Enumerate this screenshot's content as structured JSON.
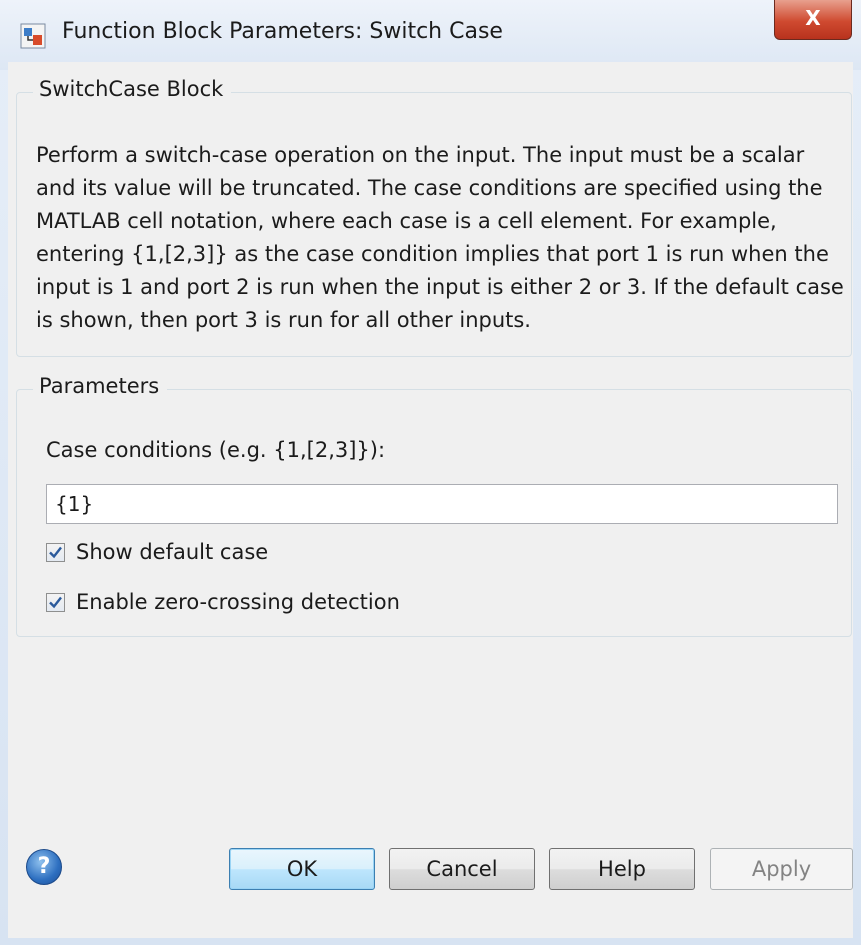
{
  "window": {
    "title": "Function Block Parameters: Switch Case",
    "close_glyph": "X",
    "icon": "simulink-block-icon"
  },
  "block_section": {
    "legend": "SwitchCase Block",
    "description": "Perform a switch-case operation on the input.  The input must be a scalar and its value will be truncated.  The case conditions are specified using the MATLAB cell notation, where each case is a cell element.  For example, entering {1,[2,3]} as the case condition implies that port 1 is run when the input is 1 and port 2 is run when the input is either 2 or 3.  If the default case is shown, then port 3 is run for all other inputs."
  },
  "parameters": {
    "legend": "Parameters",
    "case_conditions_label": "Case conditions (e.g. {1,[2,3]}):",
    "case_conditions_value": "{1}",
    "show_default_case": {
      "label": "Show default case",
      "checked": true
    },
    "zero_crossing": {
      "label": "Enable zero-crossing detection",
      "checked": true
    }
  },
  "buttons": {
    "help_icon_glyph": "?",
    "ok": "OK",
    "cancel": "Cancel",
    "help": "Help",
    "apply": "Apply"
  },
  "colors": {
    "accent": "#3c7fb1",
    "close": "#cf4a30",
    "check": "#2a5a9c"
  }
}
